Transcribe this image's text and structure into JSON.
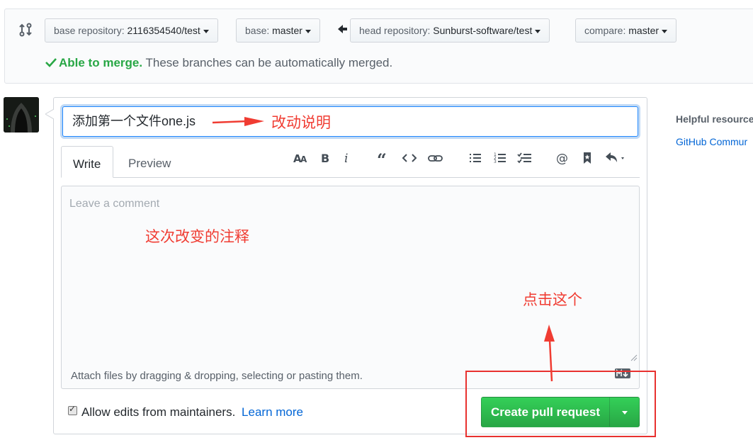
{
  "compare": {
    "base_repo_label": "base repository:",
    "base_repo_value": "2116354540/test",
    "base_label": "base:",
    "base_value": "master",
    "head_repo_label": "head repository:",
    "head_repo_value": "Sunburst-software/test",
    "compare_label": "compare:",
    "compare_value": "master",
    "merge_status": "Able to merge.",
    "merge_message": "These branches can be automatically merged."
  },
  "form": {
    "title_value": "添加第一个文件one.js",
    "tabs": [
      {
        "label": "Write",
        "active": true
      },
      {
        "label": "Preview",
        "active": false
      }
    ],
    "toolbar": [
      "header-icon",
      "bold-icon",
      "italic-icon",
      "quote-icon",
      "code-icon",
      "link-icon",
      "unordered-list-icon",
      "ordered-list-icon",
      "task-list-icon",
      "mention-icon",
      "bookmark-icon",
      "reply-icon"
    ],
    "comment_placeholder": "Leave a comment",
    "attach_text": "Attach files by dragging & dropping, selecting or pasting them.",
    "allow_edits_label": "Allow edits from maintainers.",
    "allow_edits_checked": true,
    "learn_more": "Learn more",
    "submit_label": "Create pull request"
  },
  "sidebar": {
    "title": "Helpful resource",
    "link": "GitHub Commur"
  },
  "annotations": {
    "title_note": "改动说明",
    "comment_note": "这次改变的注释",
    "click_note": "点击这个"
  },
  "colors": {
    "accent_green": "#28a745",
    "link_blue": "#0366d6",
    "annotation_red": "#f03c32"
  }
}
